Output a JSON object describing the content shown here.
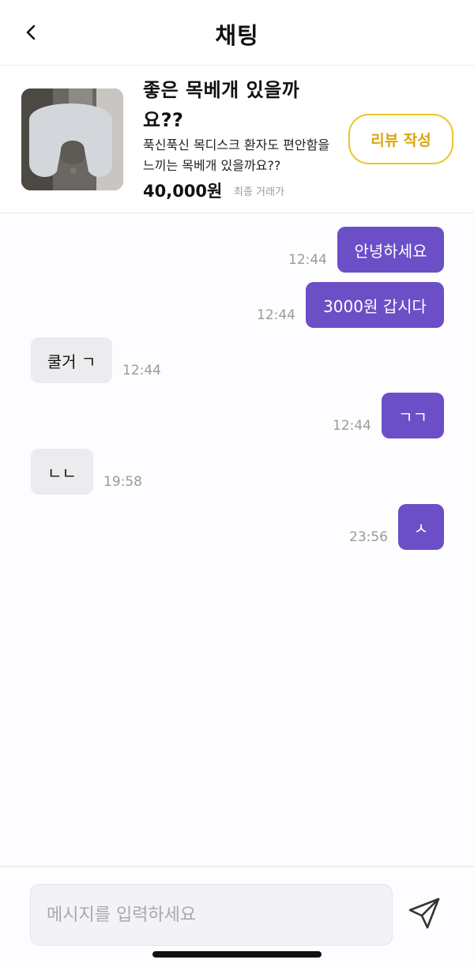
{
  "header": {
    "title": "채팅",
    "back_icon": "chevron-left-icon"
  },
  "product": {
    "title": "좋은 목베개 있을까요??",
    "description": "푹신푹신 목디스크 환자도 편안함을 느끼는 목베개 있을까요??",
    "price": "40,000원",
    "status": "최종 거래가",
    "review_button": "리뷰 작성"
  },
  "messages": [
    {
      "text": "안녕하세요",
      "time": "12:44",
      "sender": "me"
    },
    {
      "text": "3000원 갑시다",
      "time": "12:44",
      "sender": "me"
    },
    {
      "text": "쿨거 ㄱ",
      "time": "12:44",
      "sender": "other"
    },
    {
      "text": "ㄱㄱ",
      "time": "12:44",
      "sender": "me"
    },
    {
      "text": "ㄴㄴ",
      "time": "19:58",
      "sender": "other"
    },
    {
      "text": "ㅅ",
      "time": "23:56",
      "sender": "me"
    }
  ],
  "input": {
    "placeholder": "메시지를 입력하세요",
    "value": ""
  },
  "colors": {
    "my_bubble": "#6a4fc7",
    "their_bubble": "#ececef",
    "review_accent": "#ecc425"
  }
}
